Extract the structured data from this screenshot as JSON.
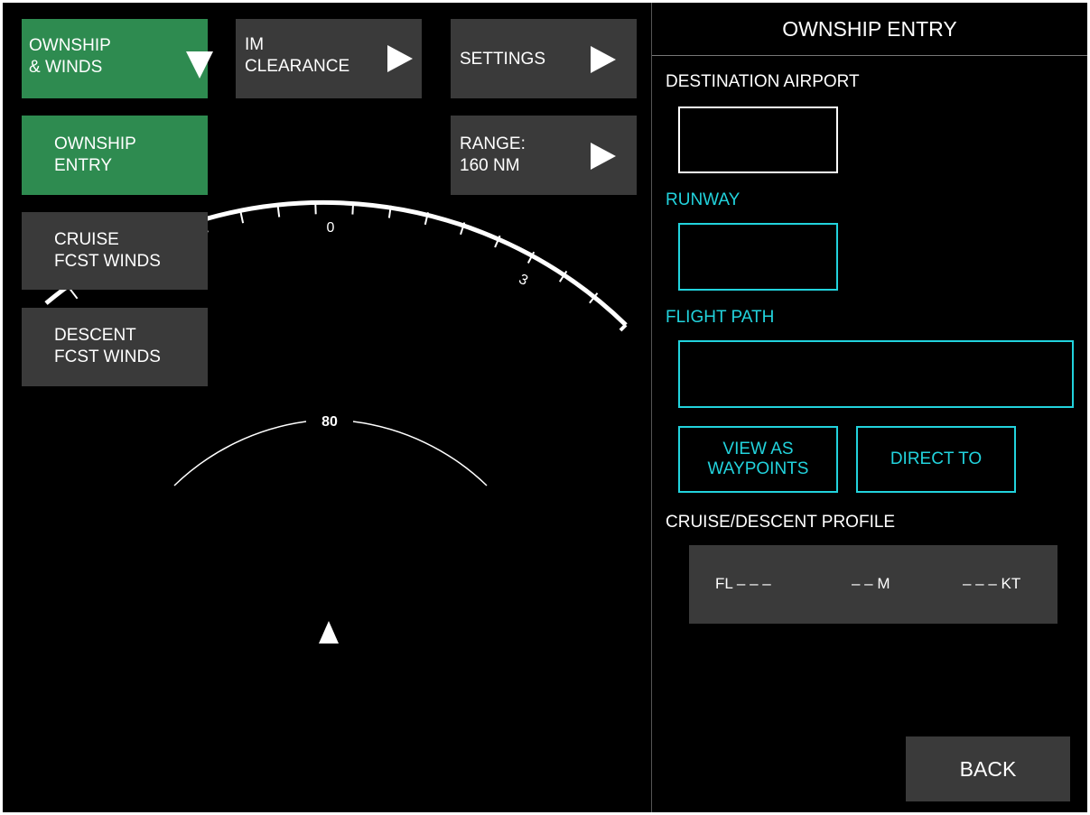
{
  "menu": {
    "ownship_winds": "OWNSHIP\n& WINDS",
    "ownship_entry": "OWNSHIP\nENTRY",
    "cruise_fcst_winds": "CRUISE\nFCST WINDS",
    "descent_fcst_winds": "DESCENT\nFCST WINDS"
  },
  "toolbar": {
    "im_clearance": "IM\nCLEARANCE",
    "settings": "SETTINGS",
    "range": "RANGE:\n160 NM"
  },
  "compass": {
    "tick_label_0": "0",
    "tick_label_3": "3",
    "range_ring_label": "80"
  },
  "panel": {
    "title": "OWNSHIP ENTRY",
    "destination_airport_label": "DESTINATION AIRPORT",
    "destination_airport_value": "",
    "runway_label": "RUNWAY",
    "runway_value": "",
    "flight_path_label": "FLIGHT PATH",
    "flight_path_value": "",
    "view_as_waypoints": "VIEW AS\nWAYPOINTS",
    "direct_to": "DIRECT TO",
    "profile_label": "CRUISE/DESCENT PROFILE",
    "profile": {
      "flight_level": "FL – – –",
      "mach": "– – M",
      "speed": "– – – KT"
    },
    "back": "BACK"
  },
  "colors": {
    "background": "#000000",
    "accent_green": "#2e8b50",
    "button_grey": "#3a3a3a",
    "cyan": "#22d3dd"
  }
}
